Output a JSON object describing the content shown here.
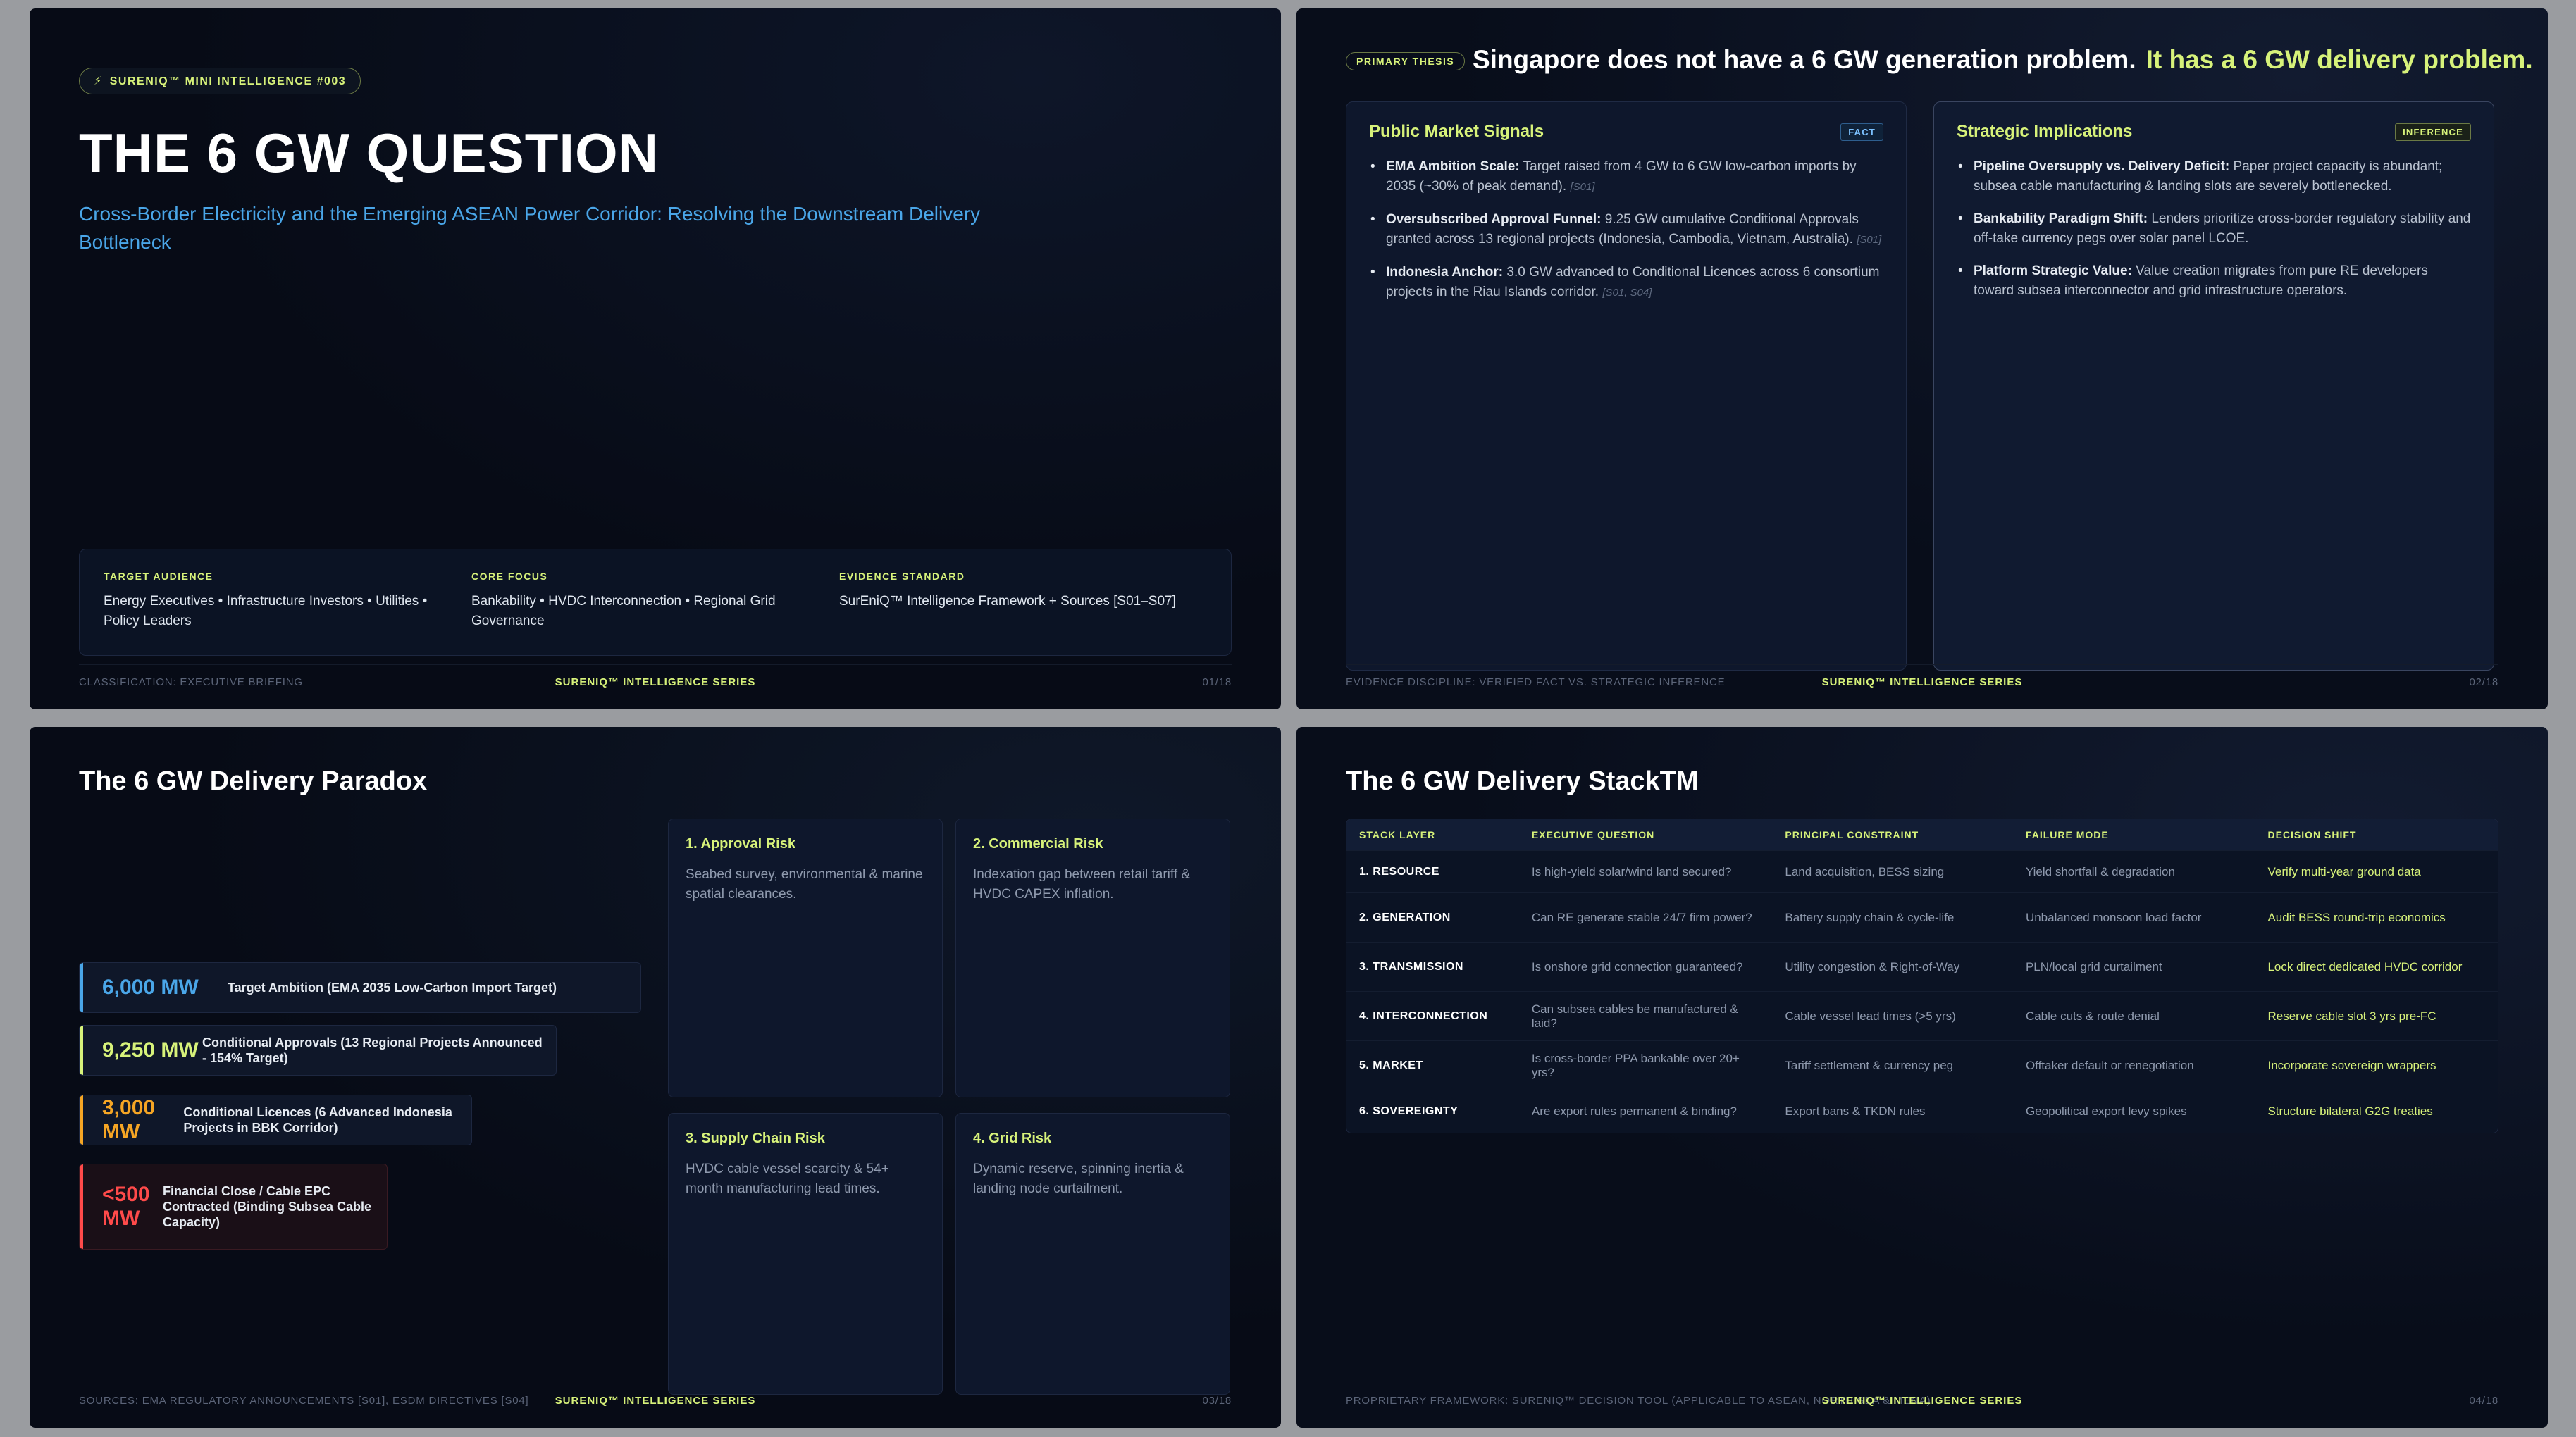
{
  "slide1": {
    "pill": "SURENIQ™ MINI INTELLIGENCE #003",
    "title": "THE 6 GW QUESTION",
    "subtitle": "Cross-Border Electricity and the Emerging ASEAN Power Corridor: Resolving the Downstream Delivery Bottleneck",
    "meta": [
      {
        "label": "TARGET AUDIENCE",
        "value": "Energy Executives • Infrastructure Investors • Utilities • Policy Leaders"
      },
      {
        "label": "CORE FOCUS",
        "value": "Bankability • HVDC Interconnection • Regional Grid Governance"
      },
      {
        "label": "EVIDENCE STANDARD",
        "value": "SurEniQ™ Intelligence Framework + Sources [S01–S07]"
      }
    ],
    "footer_left": "CLASSIFICATION: EXECUTIVE BRIEFING",
    "footer_brand": "SURENIQ™ INTELLIGENCE SERIES",
    "footer_page": "01/18"
  },
  "slide2": {
    "pill": "PRIMARY THESIS",
    "thesis_a": "Singapore does not have a 6 GW generation problem.",
    "thesis_b": "It has a 6 GW delivery problem.",
    "left": {
      "title": "Public Market Signals",
      "tag": "FACT",
      "items": [
        {
          "head": "EMA Ambition Scale:",
          "text": " Target raised from 4 GW to 6 GW low-carbon imports by 2035 (~30% of peak demand). ",
          "src": "[S01]"
        },
        {
          "head": "Oversubscribed Approval Funnel:",
          "text": " 9.25 GW cumulative Conditional Approvals granted across 13 regional projects (Indonesia, Cambodia, Vietnam, Australia). ",
          "src": "[S01]"
        },
        {
          "head": "Indonesia Anchor:",
          "text": " 3.0 GW advanced to Conditional Licences across 6 consortium projects in the Riau Islands corridor. ",
          "src": "[S01, S04]"
        }
      ]
    },
    "right": {
      "title": "Strategic Implications",
      "tag": "INFERENCE",
      "items": [
        {
          "head": "Pipeline Oversupply vs. Delivery Deficit:",
          "text": " Paper project capacity is abundant; subsea cable manufacturing & landing slots are severely bottlenecked."
        },
        {
          "head": "Bankability Paradigm Shift:",
          "text": " Lenders prioritize cross-border regulatory stability and off-take currency pegs over solar panel LCOE."
        },
        {
          "head": "Platform Strategic Value:",
          "text": " Value creation migrates from pure RE developers toward subsea interconnector and grid infrastructure operators."
        }
      ]
    },
    "footer_left": "EVIDENCE DISCIPLINE: VERIFIED FACT VS. STRATEGIC INFERENCE",
    "footer_brand": "SURENIQ™ INTELLIGENCE SERIES",
    "footer_page": "02/18"
  },
  "slide3": {
    "title": "The 6 GW Delivery Paradox",
    "funnel": [
      {
        "value": "6,000 MW",
        "label": "Target Ambition (EMA 2035 Low-Carbon Import Target)",
        "color": "#4aa6e8"
      },
      {
        "value": "9,250 MW",
        "label": "Conditional Approvals (13 Regional Projects Announced - 154% Target)",
        "color": "#d7f27a"
      },
      {
        "value": "3,000 MW",
        "label": "Conditional Licences (6 Advanced Indonesia Projects in BBK Corridor)",
        "color": "#f5a524"
      },
      {
        "value": "<500 MW",
        "label": "Financial Close / Cable EPC Contracted (Binding Subsea Cable Capacity)",
        "color": "#ff4a4a"
      }
    ],
    "risks": [
      {
        "title": "1. Approval Risk",
        "desc": "Seabed survey, environmental & marine spatial clearances."
      },
      {
        "title": "2. Commercial Risk",
        "desc": "Indexation gap between retail tariff & HVDC CAPEX inflation."
      },
      {
        "title": "3. Supply Chain Risk",
        "desc": "HVDC cable vessel scarcity & 54+ month manufacturing lead times."
      },
      {
        "title": "4. Grid Risk",
        "desc": "Dynamic reserve, spinning inertia & landing node curtailment."
      }
    ],
    "footer_left": "SOURCES: EMA REGULATORY ANNOUNCEMENTS [S01], ESDM DIRECTIVES [S04]",
    "footer_brand": "SURENIQ™ INTELLIGENCE SERIES",
    "footer_page": "03/18"
  },
  "slide4": {
    "title": "The 6 GW Delivery StackTM",
    "headers": [
      "STACK LAYER",
      "EXECUTIVE QUESTION",
      "PRINCIPAL CONSTRAINT",
      "FAILURE MODE",
      "DECISION SHIFT"
    ],
    "rows": [
      [
        "1. RESOURCE",
        "Is high-yield solar/wind land secured?",
        "Land acquisition, BESS sizing",
        "Yield shortfall & degradation",
        "Verify multi-year ground data"
      ],
      [
        "2. GENERATION",
        "Can RE generate stable 24/7 firm power?",
        "Battery supply chain & cycle-life",
        "Unbalanced monsoon load factor",
        "Audit BESS round-trip economics"
      ],
      [
        "3. TRANSMISSION",
        "Is onshore grid connection guaranteed?",
        "Utility congestion & Right-of-Way",
        "PLN/local grid curtailment",
        "Lock direct dedicated HVDC corridor"
      ],
      [
        "4. INTERCONNECTION",
        "Can subsea cables be manufactured & laid?",
        "Cable vessel lead times (>5 yrs)",
        "Cable cuts & route denial",
        "Reserve cable slot 3 yrs pre-FC"
      ],
      [
        "5. MARKET",
        "Is cross-border PPA bankable over 20+ yrs?",
        "Tariff settlement & currency peg",
        "Offtaker default or renegotiation",
        "Incorporate sovereign wrappers"
      ],
      [
        "6. SOVEREIGNTY",
        "Are export rules permanent & binding?",
        "Export bans & TKDN rules",
        "Geopolitical export levy spikes",
        "Structure bilateral G2G treaties"
      ]
    ],
    "footer_left": "PROPRIETARY FRAMEWORK: SURENIQ™ DECISION TOOL (APPLICABLE TO ASEAN, NORTH SEA & MENA)",
    "footer_brand": "SURENIQ™ INTELLIGENCE SERIES",
    "footer_page": "04/18"
  }
}
